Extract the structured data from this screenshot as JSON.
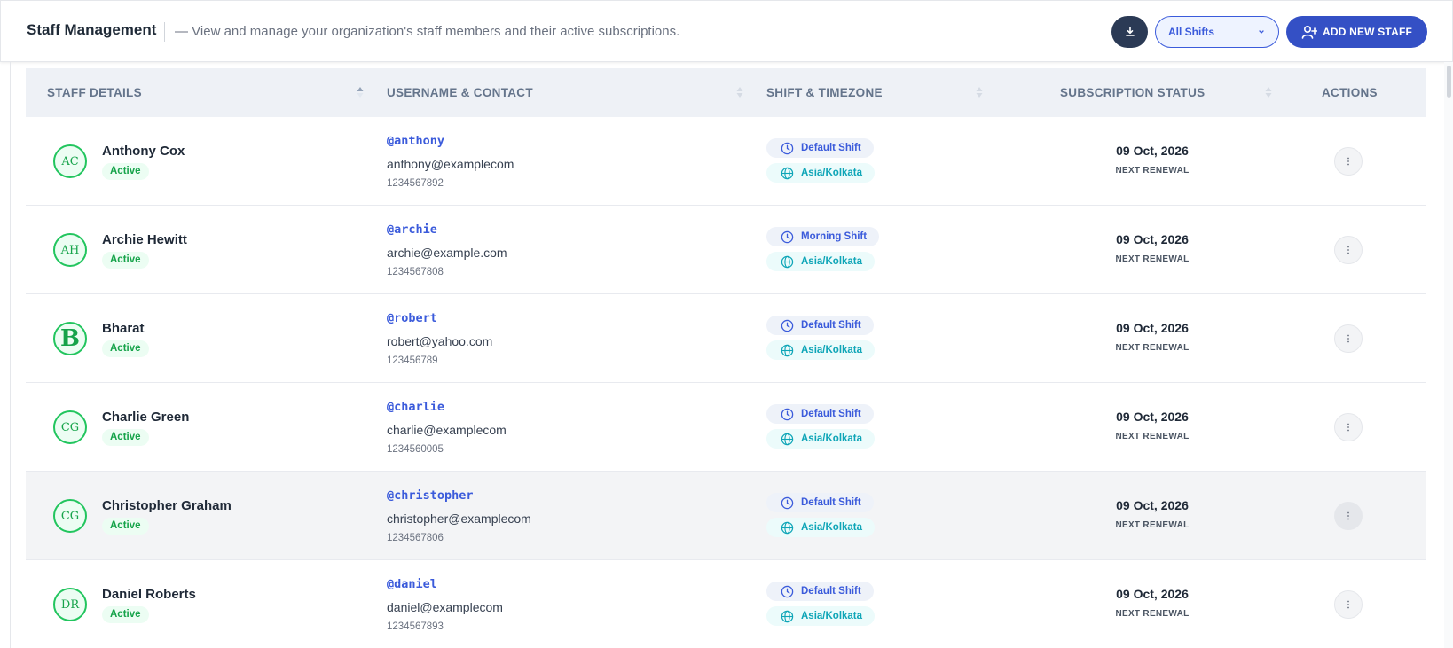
{
  "header": {
    "title": "Staff Management",
    "subtitle": "— View and manage your organization's staff members and their active subscriptions.",
    "shift_filter": "All Shifts",
    "add_button": "ADD NEW STAFF"
  },
  "table": {
    "columns": [
      "STAFF DETAILS",
      "USERNAME & CONTACT",
      "SHIFT & TIMEZONE",
      "SUBSCRIPTION STATUS",
      "ACTIONS"
    ],
    "rows": [
      {
        "initials": "AC",
        "name": "Anthony Cox",
        "status": "Active",
        "username": "@anthony",
        "email": "anthony@examplecom",
        "phone": "1234567892",
        "shift": "Default Shift",
        "timezone": "Asia/Kolkata",
        "date": "09 Oct, 2026",
        "renewal": "NEXT RENEWAL"
      },
      {
        "initials": "AH",
        "name": "Archie Hewitt",
        "status": "Active",
        "username": "@archie",
        "email": "archie@example.com",
        "phone": "1234567808",
        "shift": "Morning Shift",
        "timezone": "Asia/Kolkata",
        "date": "09 Oct, 2026",
        "renewal": "NEXT RENEWAL"
      },
      {
        "initials": "B",
        "name": "Bharat",
        "status": "Active",
        "username": "@robert",
        "email": "robert@yahoo.com",
        "phone": "123456789",
        "shift": "Default Shift",
        "timezone": "Asia/Kolkata",
        "date": "09 Oct, 2026",
        "renewal": "NEXT RENEWAL"
      },
      {
        "initials": "CG",
        "name": "Charlie Green",
        "status": "Active",
        "username": "@charlie",
        "email": "charlie@examplecom",
        "phone": "1234560005",
        "shift": "Default Shift",
        "timezone": "Asia/Kolkata",
        "date": "09 Oct, 2026",
        "renewal": "NEXT RENEWAL"
      },
      {
        "initials": "CG",
        "name": "Christopher Graham",
        "status": "Active",
        "username": "@christopher",
        "email": "christopher@examplecom",
        "phone": "1234567806",
        "shift": "Default Shift",
        "timezone": "Asia/Kolkata",
        "date": "09 Oct, 2026",
        "renewal": "NEXT RENEWAL"
      },
      {
        "initials": "DR",
        "name": "Daniel Roberts",
        "status": "Active",
        "username": "@daniel",
        "email": "daniel@examplecom",
        "phone": "1234567893",
        "shift": "Default Shift",
        "timezone": "Asia/Kolkata",
        "date": "09 Oct, 2026",
        "renewal": "NEXT RENEWAL"
      }
    ]
  },
  "colors": {
    "primary": "#3450c5",
    "dark_button": "#2b3a55",
    "active_green": "#16a34a",
    "timezone_teal": "#0ea5b7",
    "header_bg": "#eef1f6"
  },
  "icons": {
    "download": "download-icon",
    "dropdown": "chevron-down-icon",
    "add_user": "user-plus-icon",
    "sort": "sort-icon",
    "shift": "clock-icon",
    "timezone": "globe-icon",
    "actions": "more-vertical-icon"
  }
}
